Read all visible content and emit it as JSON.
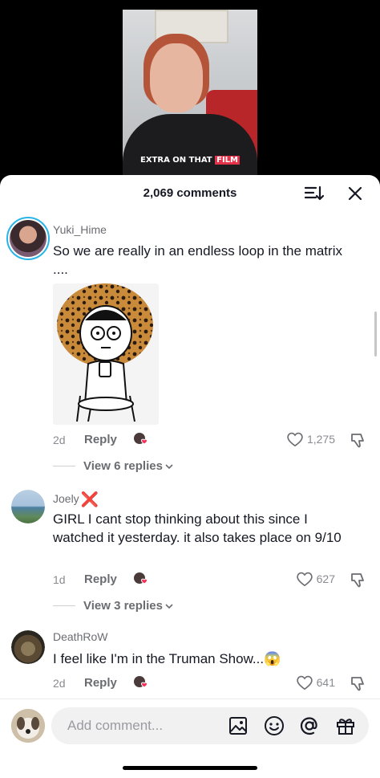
{
  "video": {
    "caption_prefix": "EXTRA ON THAT",
    "caption_highlight": "FILM"
  },
  "header": {
    "comments_count": "2,069 comments"
  },
  "comments": [
    {
      "username": "Yuki_Hime",
      "text": "So we are really in an endless loop in the matrix ....",
      "age": "2d",
      "reply_label": "Reply",
      "likes": "1,275",
      "view_replies": "View 6 replies"
    },
    {
      "username": "Joely",
      "username_badge": "❌",
      "text": "GIRL I cant stop thinking about this since I watched it yesterday. it also takes place on 9/10",
      "age": "1d",
      "reply_label": "Reply",
      "likes": "627",
      "view_replies": "View 3 replies"
    },
    {
      "username": "DeathRoW",
      "text": "I feel like I'm in the Truman Show...",
      "emoji": "😱",
      "age": "2d",
      "reply_label": "Reply",
      "likes": "641"
    }
  ],
  "input": {
    "placeholder": "Add comment..."
  },
  "icons": {
    "sort": "sort-icon",
    "close": "close-icon",
    "heart": "heart-icon",
    "dislike": "dislike-icon",
    "image": "image-icon",
    "emoji": "emoji-icon",
    "mention": "mention-icon",
    "gift": "gift-icon"
  },
  "colors": {
    "avatar_ring": "#27b5e8",
    "creator_heart": "#fe2c55",
    "badge_red": "#e02a2a"
  }
}
